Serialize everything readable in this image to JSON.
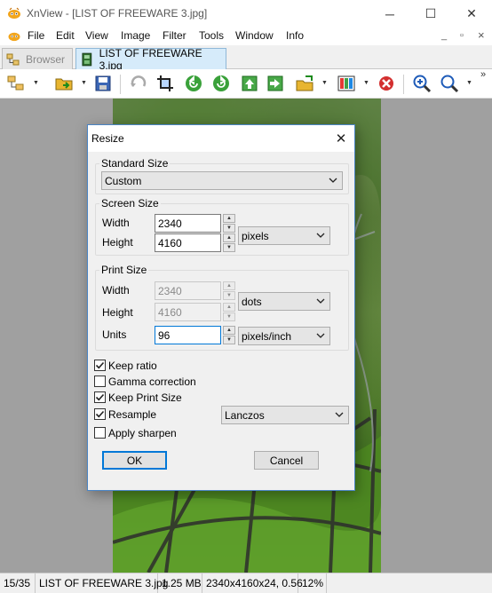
{
  "window": {
    "title": "XnView - [LIST OF FREEWARE 3.jpg]",
    "minimize_glyph": "─",
    "maximize_glyph": "☐",
    "close_glyph": "✕"
  },
  "menu": {
    "items": [
      "File",
      "Edit",
      "View",
      "Image",
      "Filter",
      "Tools",
      "Window",
      "Info"
    ],
    "mdi_min": "_",
    "mdi_restore": "▫",
    "mdi_close": "×"
  },
  "tabs": [
    {
      "label": "Browser",
      "icon": "browser-tree-icon",
      "active": false
    },
    {
      "label": "LIST OF FREEWARE 3.jpg",
      "icon": "image-file-icon",
      "active": true
    }
  ],
  "toolbar": {
    "overflow": "»",
    "icons": [
      "browser-icon",
      "open-folder-icon",
      "save-icon",
      "undo-icon",
      "crop-icon",
      "rotate-left-icon",
      "rotate-right-icon",
      "prev-image-icon",
      "next-image-icon",
      "export-icon",
      "color-adjust-icon",
      "delete-icon",
      "zoom-in-icon",
      "zoom-1to1-icon"
    ]
  },
  "dialog": {
    "title": "Resize",
    "close_glyph": "✕",
    "standard_size": {
      "group_label": "Standard Size",
      "value": "Custom"
    },
    "screen_size": {
      "group_label": "Screen Size",
      "width_label": "Width",
      "width_value": "2340",
      "height_label": "Height",
      "height_value": "4160",
      "unit": "pixels"
    },
    "print_size": {
      "group_label": "Print Size",
      "width_label": "Width",
      "width_value": "2340",
      "height_label": "Height",
      "height_value": "4160",
      "unit": "dots",
      "units_label": "Units",
      "units_value": "96",
      "units_unit": "pixels/inch"
    },
    "options": [
      {
        "label": "Keep ratio",
        "checked": true
      },
      {
        "label": "Gamma correction",
        "checked": false
      },
      {
        "label": "Keep Print Size",
        "checked": true
      },
      {
        "label": "Resample",
        "checked": true
      },
      {
        "label": "Apply sharpen",
        "checked": false
      }
    ],
    "resample_method": "Lanczos",
    "ok_label": "OK",
    "cancel_label": "Cancel"
  },
  "status": {
    "index": "15/35",
    "filename": "LIST OF FREEWARE 3.jpg",
    "filesize": "1.25 MB",
    "dimensions": "2340x4160x24, 0.56",
    "zoom": "12%"
  },
  "colors": {
    "accent": "#0078d7",
    "tab_active_bg": "#d6ebfa",
    "canvas_bg": "#a0a0a0"
  }
}
